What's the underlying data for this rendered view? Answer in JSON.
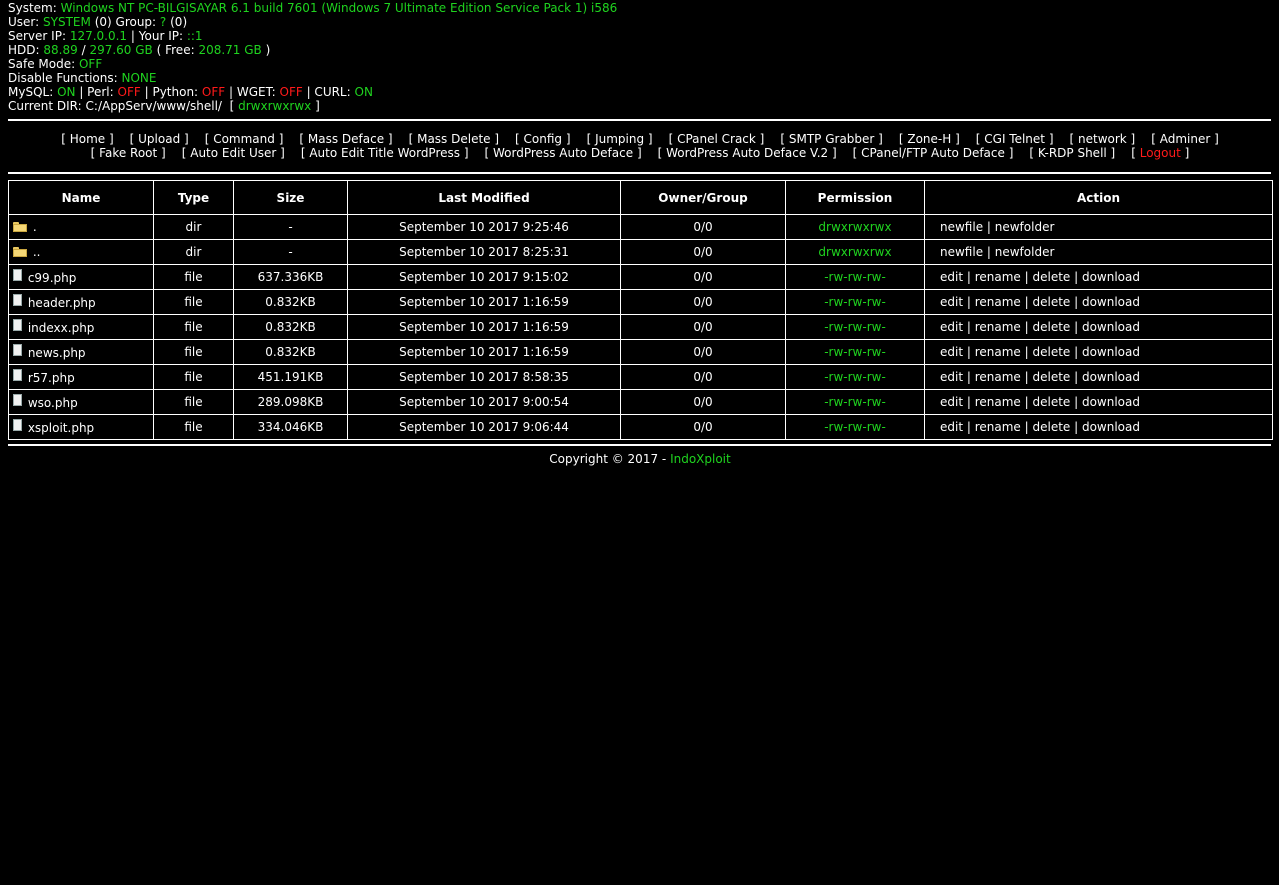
{
  "info": {
    "system_label": "System:",
    "system_value": "Windows NT PC-BILGISAYAR 6.1 build 7601 (Windows 7 Ultimate Edition Service Pack 1) i586",
    "user_label": "User:",
    "user_value": "SYSTEM",
    "user_id": "(0)",
    "group_label": "Group:",
    "group_value": "?",
    "group_id": "(0)",
    "server_ip_label": "Server IP:",
    "server_ip": "127.0.0.1",
    "your_ip_label": "| Your IP:",
    "your_ip": "::1",
    "hdd_label": "HDD:",
    "hdd_used": "88.89",
    "hdd_sep": "/",
    "hdd_total": "297.60 GB",
    "hdd_free_label": "( Free:",
    "hdd_free": "208.71 GB",
    "hdd_close": ")",
    "safe_mode_label": "Safe Mode:",
    "safe_mode": "OFF",
    "disable_functions_label": "Disable Functions:",
    "disable_functions": "NONE",
    "mysql_label": "MySQL:",
    "mysql": "ON",
    "perl_label": "| Perl:",
    "perl": "OFF",
    "python_label": "| Python:",
    "python": "OFF",
    "wget_label": "| WGET:",
    "wget": "OFF",
    "curl_label": "| CURL:",
    "curl": "ON",
    "current_dir_label": "Current DIR:",
    "current_dir": "C:/AppServ/www/shell/",
    "dir_perm_open": "[",
    "dir_perm": "drwxrwxrwx",
    "dir_perm_close": "]"
  },
  "menu": {
    "row1": [
      "Home",
      "Upload",
      "Command",
      "Mass Deface",
      "Mass Delete",
      "Config",
      "Jumping",
      "CPanel Crack",
      "SMTP Grabber",
      "Zone-H",
      "CGI Telnet",
      "network",
      "Adminer"
    ],
    "row2": [
      "Fake Root",
      "Auto Edit User",
      "Auto Edit Title WordPress",
      "WordPress Auto Deface",
      "WordPress Auto Deface V.2",
      "CPanel/FTP Auto Deface",
      "K-RDP Shell"
    ],
    "logout": "Logout"
  },
  "table": {
    "headers": [
      "Name",
      "Type",
      "Size",
      "Last Modified",
      "Owner/Group",
      "Permission",
      "Action"
    ],
    "rows": [
      {
        "icon": "folder-icon",
        "name": ".",
        "type": "dir",
        "size": "-",
        "modified": "September 10 2017 9:25:46",
        "owner": "0/0",
        "perm": "drwxrwxrwx",
        "actions": [
          "newfile",
          "newfolder"
        ]
      },
      {
        "icon": "folder-icon",
        "name": "..",
        "type": "dir",
        "size": "-",
        "modified": "September 10 2017 8:25:31",
        "owner": "0/0",
        "perm": "drwxrwxrwx",
        "actions": [
          "newfile",
          "newfolder"
        ]
      },
      {
        "icon": "file-icon",
        "name": "c99.php",
        "type": "file",
        "size": "637.336KB",
        "modified": "September 10 2017 9:15:02",
        "owner": "0/0",
        "perm": "-rw-rw-rw-",
        "actions": [
          "edit",
          "rename",
          "delete",
          "download"
        ]
      },
      {
        "icon": "file-icon",
        "name": "header.php",
        "type": "file",
        "size": "0.832KB",
        "modified": "September 10 2017 1:16:59",
        "owner": "0/0",
        "perm": "-rw-rw-rw-",
        "actions": [
          "edit",
          "rename",
          "delete",
          "download"
        ]
      },
      {
        "icon": "file-icon",
        "name": "indexx.php",
        "type": "file",
        "size": "0.832KB",
        "modified": "September 10 2017 1:16:59",
        "owner": "0/0",
        "perm": "-rw-rw-rw-",
        "actions": [
          "edit",
          "rename",
          "delete",
          "download"
        ]
      },
      {
        "icon": "file-icon",
        "name": "news.php",
        "type": "file",
        "size": "0.832KB",
        "modified": "September 10 2017 1:16:59",
        "owner": "0/0",
        "perm": "-rw-rw-rw-",
        "actions": [
          "edit",
          "rename",
          "delete",
          "download"
        ]
      },
      {
        "icon": "file-icon",
        "name": "r57.php",
        "type": "file",
        "size": "451.191KB",
        "modified": "September 10 2017 8:58:35",
        "owner": "0/0",
        "perm": "-rw-rw-rw-",
        "actions": [
          "edit",
          "rename",
          "delete",
          "download"
        ]
      },
      {
        "icon": "file-icon",
        "name": "wso.php",
        "type": "file",
        "size": "289.098KB",
        "modified": "September 10 2017 9:00:54",
        "owner": "0/0",
        "perm": "-rw-rw-rw-",
        "actions": [
          "edit",
          "rename",
          "delete",
          "download"
        ]
      },
      {
        "icon": "file-icon",
        "name": "xsploit.php",
        "type": "file",
        "size": "334.046KB",
        "modified": "September 10 2017 9:06:44",
        "owner": "0/0",
        "perm": "-rw-rw-rw-",
        "actions": [
          "edit",
          "rename",
          "delete",
          "download"
        ]
      }
    ]
  },
  "footer": {
    "copyright": "Copyright © 2017 -",
    "brand": "IndoXploit"
  },
  "colors": {
    "background": "#000000",
    "text": "#ffffff",
    "accent_green": "#1fd31f",
    "accent_red": "#ff1a1a"
  }
}
